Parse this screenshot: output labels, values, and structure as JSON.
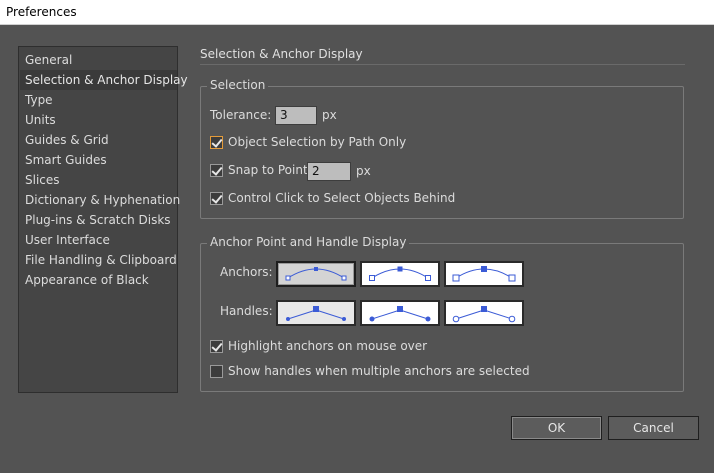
{
  "window": {
    "title": "Preferences"
  },
  "sidebar": {
    "items": [
      {
        "label": "General",
        "selected": false
      },
      {
        "label": "Selection & Anchor Display",
        "selected": true
      },
      {
        "label": "Type",
        "selected": false
      },
      {
        "label": "Units",
        "selected": false
      },
      {
        "label": "Guides & Grid",
        "selected": false
      },
      {
        "label": "Smart Guides",
        "selected": false
      },
      {
        "label": "Slices",
        "selected": false
      },
      {
        "label": "Dictionary & Hyphenation",
        "selected": false
      },
      {
        "label": "Plug-ins & Scratch Disks",
        "selected": false
      },
      {
        "label": "User Interface",
        "selected": false
      },
      {
        "label": "File Handling & Clipboard",
        "selected": false
      },
      {
        "label": "Appearance of Black",
        "selected": false
      }
    ]
  },
  "main": {
    "section_title": "Selection & Anchor Display",
    "selection": {
      "legend": "Selection",
      "tolerance_label": "Tolerance:",
      "tolerance_value": "3",
      "tolerance_unit": "px",
      "object_selection_label": "Object Selection by Path Only",
      "object_selection_checked": true,
      "snap_label": "Snap to Point",
      "snap_checked": true,
      "snap_value": "2",
      "snap_unit": "px",
      "control_click_label": "Control Click to Select Objects Behind",
      "control_click_checked": true
    },
    "anchor": {
      "legend": "Anchor Point and Handle Display",
      "anchors_label": "Anchors:",
      "anchors_selected_index": 0,
      "handles_label": "Handles:",
      "handles_selected_index": null,
      "highlight_label": "Highlight anchors on mouse over",
      "highlight_checked": true,
      "show_handles_label": "Show handles when multiple anchors are selected",
      "show_handles_checked": false
    }
  },
  "buttons": {
    "ok_label": "OK",
    "cancel_label": "Cancel"
  },
  "colors": {
    "accent_blue": "#3b5bd6",
    "focus_orange": "#e39b3a",
    "panel_bg": "#535353"
  }
}
